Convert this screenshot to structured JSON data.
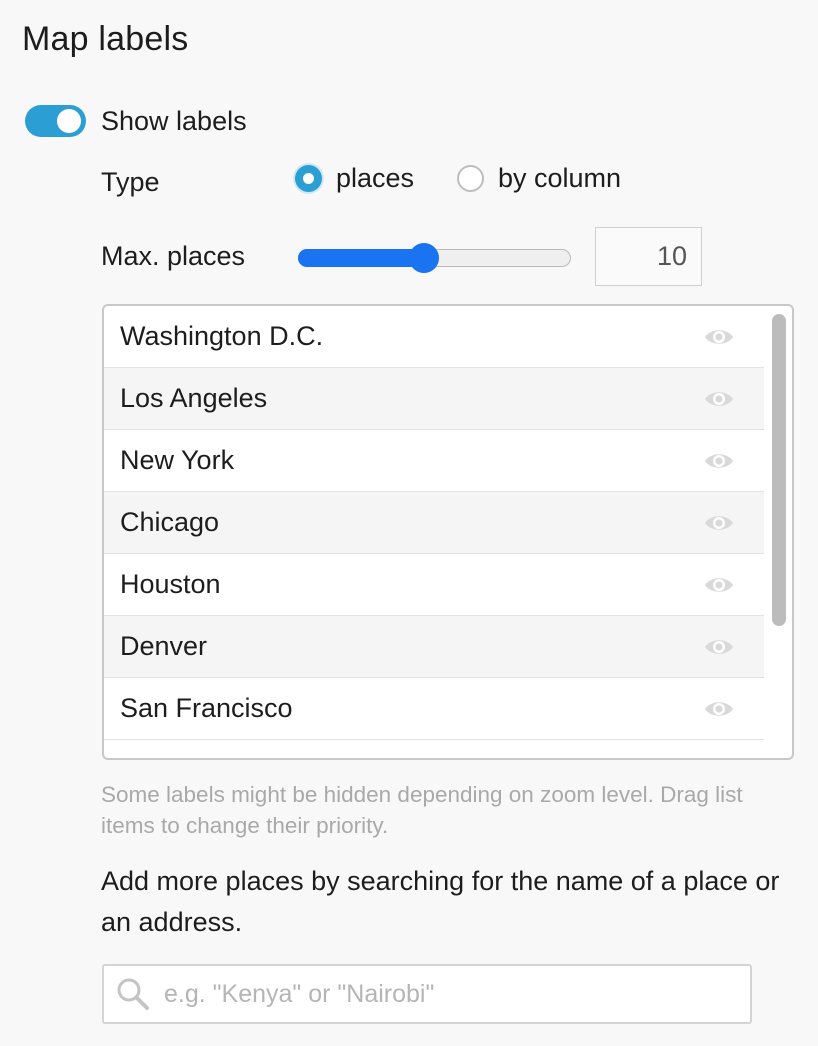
{
  "section_title": "Map labels",
  "show_labels": {
    "label": "Show labels",
    "on": true
  },
  "type": {
    "label": "Type",
    "options": [
      {
        "label": "places",
        "selected": true
      },
      {
        "label": "by column",
        "selected": false
      }
    ]
  },
  "max_places": {
    "label": "Max. places",
    "value": "10",
    "slider_fraction": 0.46
  },
  "places_list": [
    {
      "name": "Washington D.C.",
      "icon": "eye-icon"
    },
    {
      "name": "Los Angeles",
      "icon": "eye-icon"
    },
    {
      "name": "New York",
      "icon": "eye-icon"
    },
    {
      "name": "Chicago",
      "icon": "eye-icon"
    },
    {
      "name": "Houston",
      "icon": "eye-icon"
    },
    {
      "name": "Denver",
      "icon": "eye-icon"
    },
    {
      "name": "San Francisco",
      "icon": "eye-icon"
    }
  ],
  "hint": "Some labels might be hidden depending on zoom level. Drag list items to change their priority.",
  "add_more_text": "Add more places by searching for the name of a place or an address.",
  "search": {
    "placeholder": "e.g. \"Kenya\" or \"Nairobi\""
  },
  "colors": {
    "accent": "#2b9fd4",
    "slider": "#1a73f0"
  }
}
